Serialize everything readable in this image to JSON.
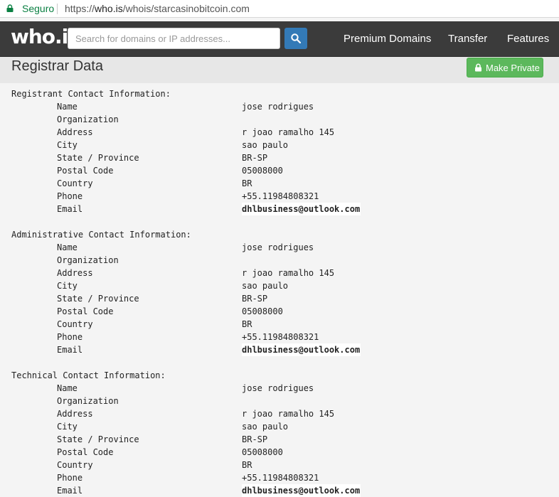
{
  "browser": {
    "secure_label": "Seguro",
    "url_scheme": "https://",
    "url_host": "who.is",
    "url_path": "/whois/starcasinobitcoin.com"
  },
  "nav": {
    "logo": "who.is",
    "search_placeholder": "Search for domains or IP addresses...",
    "links": [
      "Premium Domains",
      "Transfer",
      "Features"
    ]
  },
  "header": {
    "title": "Registrar Data",
    "make_private": "Make Private"
  },
  "whois": {
    "labels": {
      "name": "Name",
      "organization": "Organization",
      "address": "Address",
      "city": "City",
      "state": "State / Province",
      "postal": "Postal Code",
      "country": "Country",
      "phone": "Phone",
      "email": "Email"
    },
    "sections": [
      {
        "heading": "Registrant Contact Information:",
        "name": "jose rodrigues",
        "organization": "",
        "address": "r joao ramalho 145",
        "city": "sao paulo",
        "state": "BR-SP",
        "postal": "05008000",
        "country": "BR",
        "phone": "+55.11984808321",
        "email": "dhlbusiness@outlook.com"
      },
      {
        "heading": "Administrative Contact Information:",
        "name": "jose rodrigues",
        "organization": "",
        "address": "r joao ramalho 145",
        "city": "sao paulo",
        "state": "BR-SP",
        "postal": "05008000",
        "country": "BR",
        "phone": "+55.11984808321",
        "email": "dhlbusiness@outlook.com"
      },
      {
        "heading": "Technical Contact Information:",
        "name": "jose rodrigues",
        "organization": "",
        "address": "r joao ramalho 145",
        "city": "sao paulo",
        "state": "BR-SP",
        "postal": "05008000",
        "country": "BR",
        "phone": "+55.11984808321",
        "email": "dhlbusiness@outlook.com"
      }
    ]
  },
  "colors": {
    "nav_bg": "#3b3b3b",
    "search_button": "#337ab7",
    "make_private_button": "#5cb85c",
    "secure_green": "#0b8043"
  }
}
